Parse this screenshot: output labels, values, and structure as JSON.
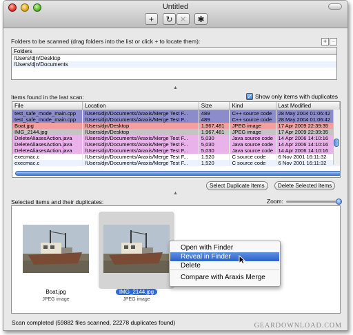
{
  "window": {
    "title": "Untitled"
  },
  "toolbar": {
    "buttons": [
      {
        "name": "add",
        "glyph": "+"
      },
      {
        "name": "refresh",
        "glyph": "↻"
      },
      {
        "name": "remove",
        "glyph": "✕"
      },
      {
        "name": "settings",
        "glyph": "✱"
      }
    ]
  },
  "folders": {
    "label": "Folders to be scanned (drag folders into the list or click + to locate them):",
    "add_glyph": "+",
    "remove_glyph": "−",
    "header": "Folders",
    "items": [
      "/Users/djn/Desktop",
      "/Users/djn/Documents"
    ]
  },
  "items": {
    "label": "Items found in the last scan:",
    "show_dup_label": "Show only items with duplicates",
    "show_dup_checked": true,
    "columns": [
      "File",
      "Location",
      "Size",
      "Kind",
      "Last Modified"
    ],
    "rows": [
      {
        "file": "test_safe_mode_main.cpp",
        "location": "/Users/djn/Documents/Araxis/Merge Test F...",
        "size": "489",
        "kind": "C++ source code",
        "modified": "28 May 2004 01:06:42",
        "color": "#8c8ccc"
      },
      {
        "file": "test_safe_mode_main.cpp",
        "location": "/Users/djn/Documents/Araxis/Merge Test F...",
        "size": "489",
        "kind": "C++ source code",
        "modified": "28 May 2004 01:06:42",
        "color": "#8c8ccc"
      },
      {
        "file": "Boat.jpg",
        "location": "/Users/djn/Desktop",
        "size": "1,967,481",
        "kind": "JPEG image",
        "modified": "17 Apr 2009 22:39:35",
        "color": "#f0a0a0"
      },
      {
        "file": "IMG_2144.jpg",
        "location": "/Users/djn/Desktop",
        "size": "1,967,481",
        "kind": "JPEG image",
        "modified": "17 Apr 2009 22:39:35",
        "color": "#c4c4c4"
      },
      {
        "file": "DeleteAliasesAction.java",
        "location": "/Users/djn/Documents/Araxis/Merge Test F...",
        "size": "5,030",
        "kind": "Java source code",
        "modified": "14 Apr 2006 14:10:16",
        "color": "#eab2ea"
      },
      {
        "file": "DeleteAliasesAction.java",
        "location": "/Users/djn/Documents/Araxis/Merge Test F...",
        "size": "5,030",
        "kind": "Java source code",
        "modified": "14 Apr 2006 14:10:16",
        "color": "#eab2ea"
      },
      {
        "file": "DeleteAliasesAction.java",
        "location": "/Users/djn/Documents/Araxis/Merge Test F...",
        "size": "5,030",
        "kind": "Java source code",
        "modified": "14 Apr 2006 14:10:16",
        "color": "#eab2ea"
      },
      {
        "file": "execmac.c",
        "location": "/Users/djn/Documents/Araxis/Merge Test F...",
        "size": "1,520",
        "kind": "C source code",
        "modified": "6 Nov 2001 16:11:32",
        "color": "#ffffff"
      },
      {
        "file": "execmac.c",
        "location": "/Users/djn/Documents/Araxis/Merge Test F...",
        "size": "1,520",
        "kind": "C source code",
        "modified": "6 Nov 2001 16:11:32",
        "color": "#edf3fe"
      }
    ],
    "select_dup_label": "Select Duplicate Items",
    "delete_sel_label": "Delete Selected Items"
  },
  "preview": {
    "label": "Selected items and their duplicates:",
    "zoom_label": "Zoom:",
    "zoom_level": 1.0,
    "items": [
      {
        "name": "Boat.jpg",
        "kind": "JPEG image",
        "selected": false
      },
      {
        "name": "IMG_2144.jpg",
        "kind": "JPEG image",
        "selected": true
      }
    ]
  },
  "context_menu": {
    "items": [
      "Open with Finder",
      "Reveal in Finder",
      "Delete",
      "Compare with Araxis Merge"
    ],
    "highlighted": "Reveal in Finder"
  },
  "status": "Scan completed (59882 files scanned, 22278 duplicates found)",
  "watermark": "GEARDOWNLOAD.COM",
  "colors": {
    "accent": "#2f6ad0",
    "highlight": "#3b6fd4"
  }
}
